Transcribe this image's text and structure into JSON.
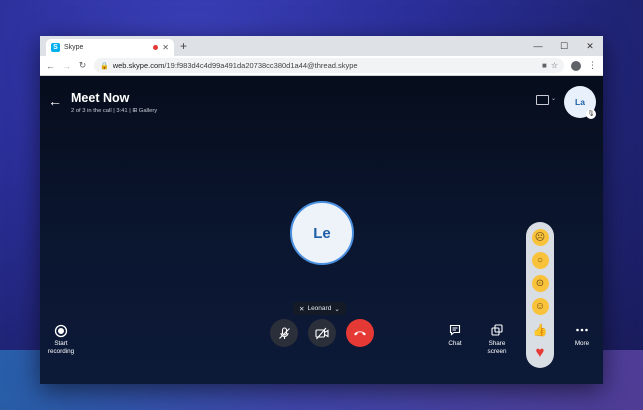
{
  "browser": {
    "tab_title": "Skype",
    "tab_favicon": "S",
    "new_tab": "+",
    "url_host": "web.skype.com",
    "url_path": "/19:f983d4c4d99a491da20738cc380d1a44@thread.skype"
  },
  "call": {
    "title": "Meet Now",
    "subtitle": "2 of 3 in the call | 3:41 | ⊞ Gallery",
    "self_initials": "La",
    "participant_initials": "Le",
    "device_name": "Leonard"
  },
  "controls": {
    "start_recording": "Start recording",
    "chat": "Chat",
    "share_screen": "Share screen",
    "more": "More"
  },
  "reactions": [
    {
      "name": "sad-emoji-icon",
      "glyph": "☹"
    },
    {
      "name": "surprised-emoji-icon",
      "glyph": "○"
    },
    {
      "name": "wow-emoji-icon",
      "glyph": "⊙"
    },
    {
      "name": "laugh-emoji-icon",
      "glyph": "☺"
    },
    {
      "name": "thumbs-up-icon",
      "glyph": "👍"
    },
    {
      "name": "heart-icon",
      "glyph": "♥"
    }
  ],
  "colors": {
    "accent": "#4a8fe0",
    "hangup": "#e53935",
    "emoji": "#f8c33b",
    "heart": "#e53935"
  }
}
